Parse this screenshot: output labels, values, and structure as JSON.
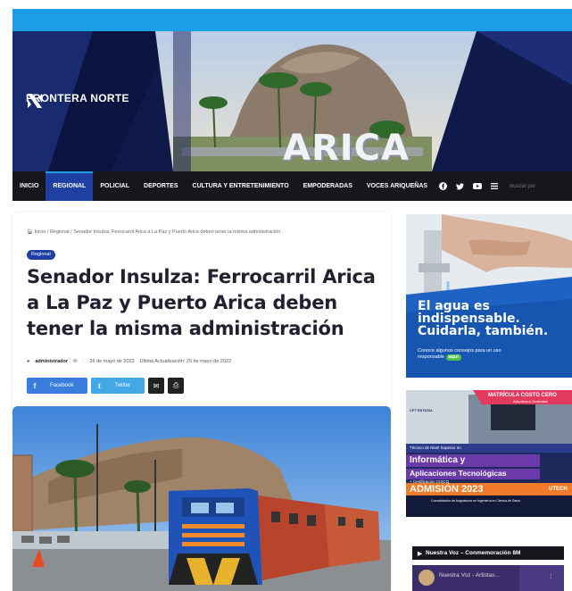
{
  "site": {
    "name": "FRONTERA NORTE",
    "banner_city": "ARICA"
  },
  "nav": {
    "items": [
      {
        "label": "INICIO",
        "active": false
      },
      {
        "label": "REGIONAL",
        "active": true
      },
      {
        "label": "POLICIAL",
        "active": false
      },
      {
        "label": "DEPORTES",
        "active": false
      },
      {
        "label": "CULTURA Y ENTRETENIMIENTO",
        "active": false
      },
      {
        "label": "EMPODERADAS",
        "active": false
      },
      {
        "label": "VOCES ARIQUEÑAS",
        "active": false
      }
    ],
    "search_placeholder": "Buscar por",
    "icons": [
      "facebook-icon",
      "twitter-icon",
      "youtube-icon",
      "menu-icon",
      "search-icon"
    ]
  },
  "article": {
    "breadcrumb": "Inicio / Regional / Senador Insulza: Ferrocarril Arica a La Paz y Puerto Arica deben tener la misma administración",
    "tag": "Regional",
    "title": "Senador Insulza: Ferrocarril Arica a La Paz y Puerto Arica deben tener la misma administración",
    "author": "administrador",
    "date": "26 de mayo de 2022",
    "updated": "Última Actualización: 29 de mayo de 2022",
    "share": {
      "facebook": "Facebook",
      "twitter": "Twitter"
    }
  },
  "sidebar": {
    "ad1": {
      "headline_1": "El agua es",
      "headline_2": "indispensable.",
      "headline_3": "Cuidarla, también.",
      "sub": "Conoce algunos consejos para un uso responsable",
      "pill": "aquí"
    },
    "ad2": {
      "badge": "MATRÍCULA COSTO CERO",
      "badge_sub": "Adscritos a Gratuidad",
      "org": "CFT ESTATAL",
      "level": "Técnico de Nivel Superior en",
      "program_1": "Informática y",
      "program_2": "Aplicaciones Tecnológicas",
      "cert": "+ Certificación CISCO",
      "admission": "ADMISIÓN 2023",
      "partner": "UTECH",
      "footer": "Convalidación de Asignaturas en Ingeniería en Ciencia de Datos"
    },
    "video": {
      "header": "Nuestra Voz – Conmemoración 8M",
      "title": "Nuestra Voz - Artistas..."
    }
  },
  "colors": {
    "brand_blue": "#1c9ee6",
    "nav_bg": "#15171c",
    "nav_active": "#1f3fa3",
    "facebook": "#3a7ddc",
    "twitter": "#42a8e6"
  }
}
